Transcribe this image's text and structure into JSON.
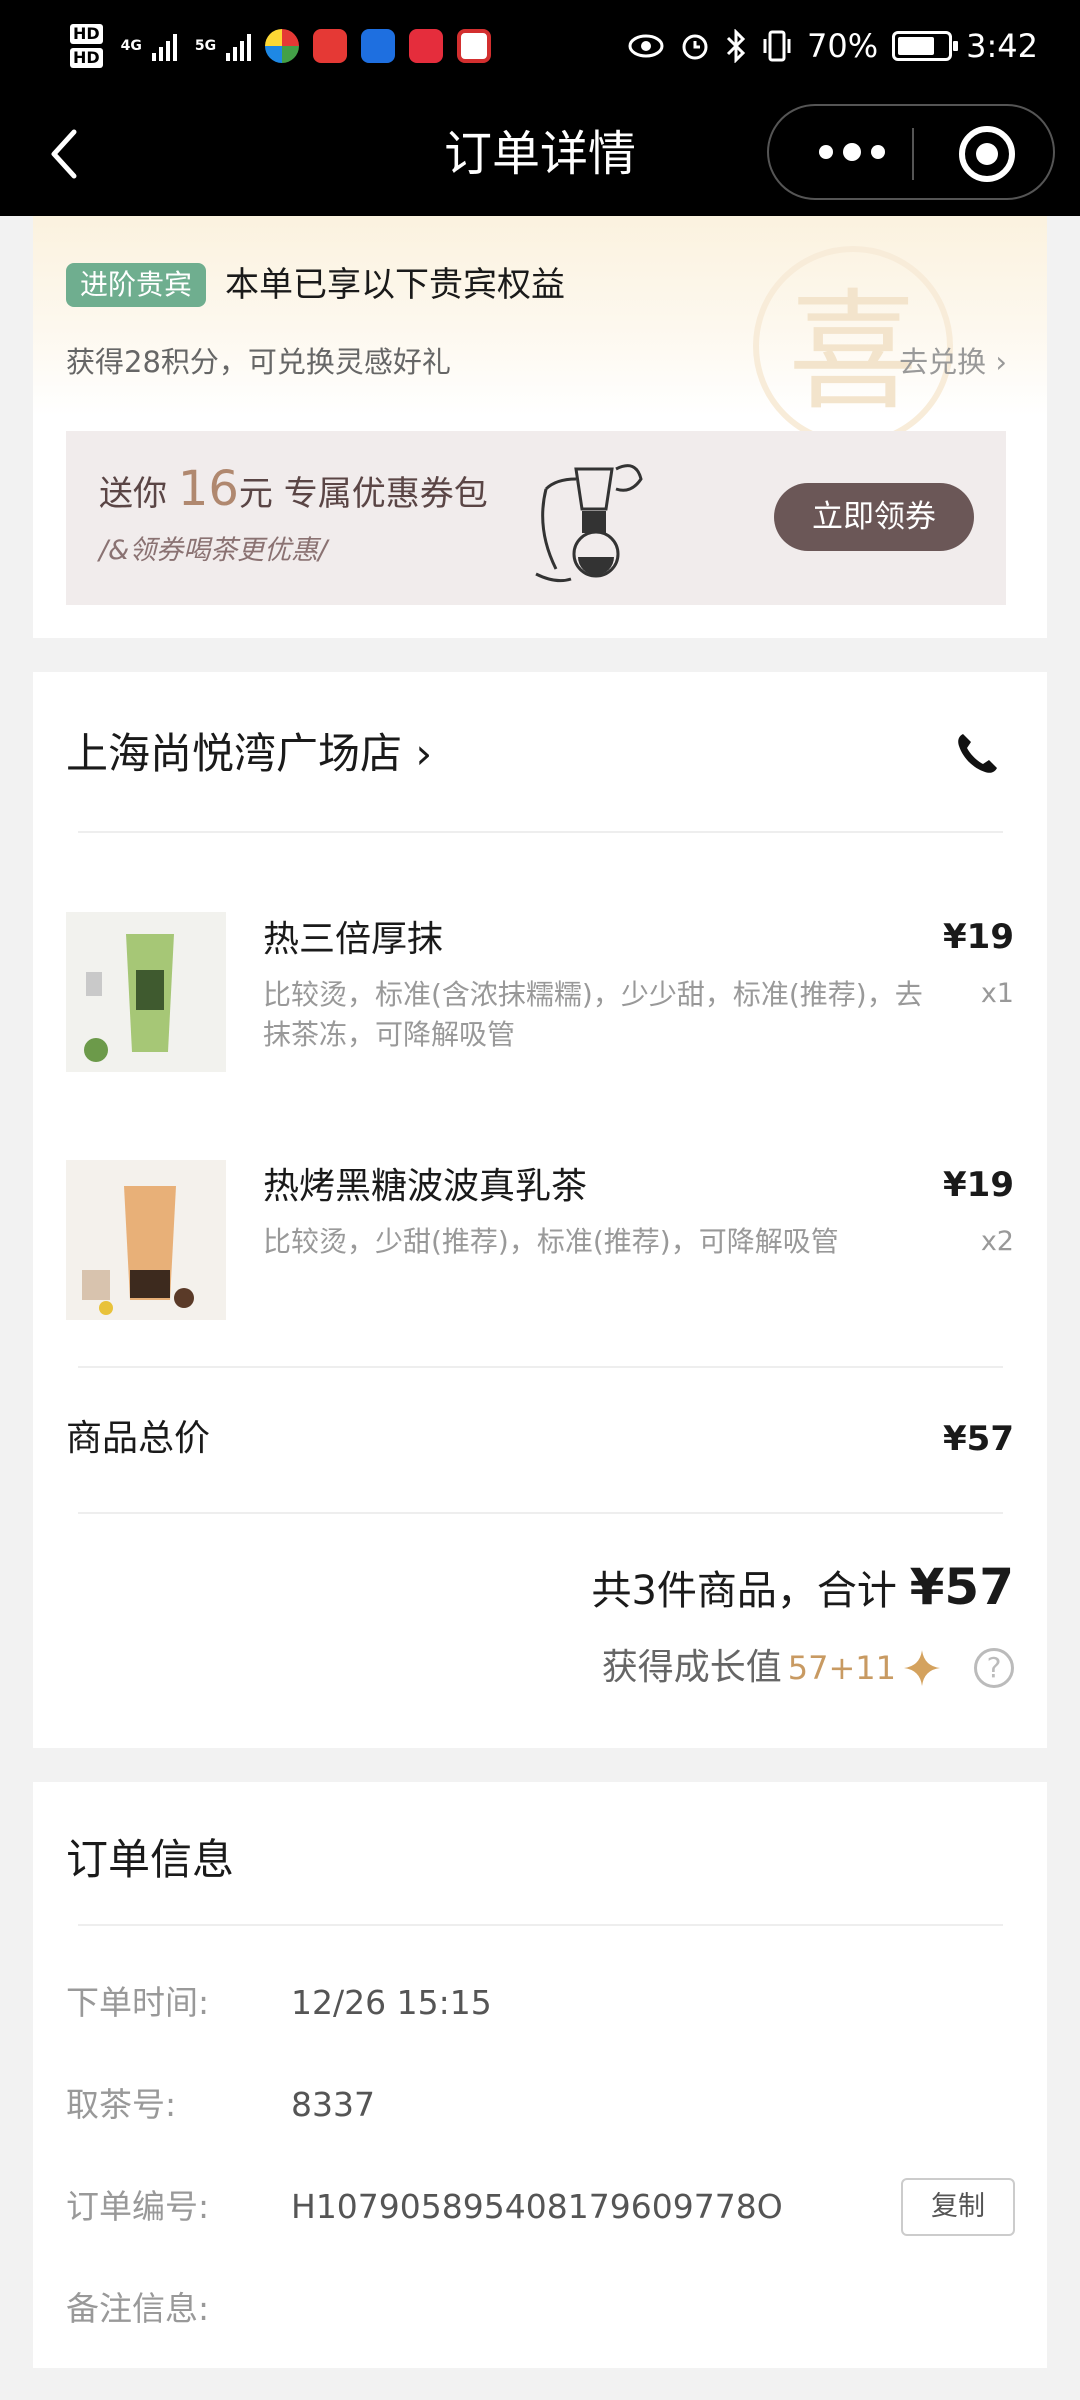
{
  "statusbar": {
    "hd1": "HD",
    "hd2": "HD",
    "net1": "4G",
    "net2": "5G",
    "battery": "70%",
    "time": "3:42"
  },
  "navbar": {
    "title": "订单详情"
  },
  "vip": {
    "badge": "进阶贵宾",
    "title": "本单已享以下贵宾权益",
    "points_text": "获得28积分，可兑换灵感好礼",
    "redeem_link": "去兑换 ›",
    "watermark": "喜",
    "coupon": {
      "prefix": "送你",
      "amount": "16",
      "suffix": "元 专属优惠券包",
      "subtitle": "/&领券喝茶更优惠/",
      "button": "立即领券"
    }
  },
  "order": {
    "store_name": "上海尚悦湾广场店 ›",
    "items": [
      {
        "name": "热三倍厚抹",
        "desc": "比较烫，标准(含浓抹糯糯)，少少甜，标准(推荐)，去抹茶冻，可降解吸管",
        "price": "¥19",
        "qty": "x1"
      },
      {
        "name": "热烤黑糖波波真乳茶",
        "desc": "比较烫，少甜(推荐)，标准(推荐)，可降解吸管",
        "price": "¥19",
        "qty": "x2"
      }
    ],
    "subtotal_label": "商品总价",
    "subtotal_value": "¥57",
    "total_prefix": "共3件商品，合计 ",
    "total_amount": "¥57",
    "growth_label": "获得成长值",
    "growth_value": "57+11",
    "help": "?"
  },
  "info": {
    "title": "订单信息",
    "rows": [
      {
        "label": "下单时间:",
        "value": "12/26 15:15"
      },
      {
        "label": "取茶号:",
        "value": "8337"
      },
      {
        "label": "订单编号:",
        "value": "H107905895408179609778O"
      },
      {
        "label": "备注信息:",
        "value": ""
      }
    ],
    "copy_button": "复制"
  }
}
